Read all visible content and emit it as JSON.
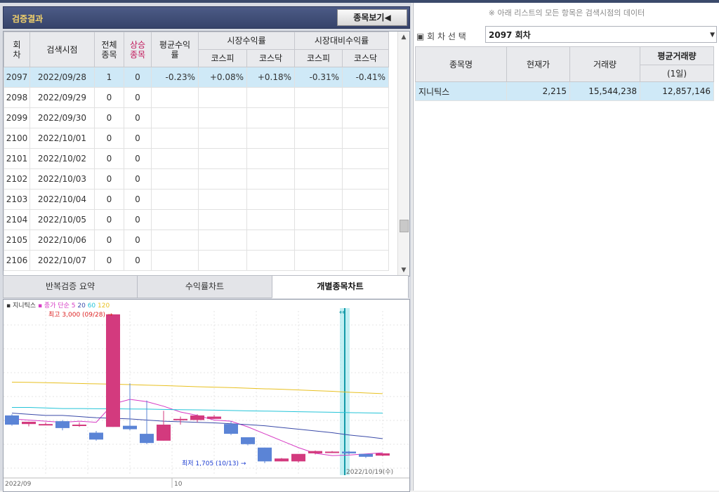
{
  "left": {
    "title": "검증결과",
    "view_button": "종목보기◀",
    "grid": {
      "headers": {
        "round": "회차",
        "date": "검색시점",
        "total": "전체종목",
        "rise": "상승종목",
        "avg": "평균수익률",
        "market": "시장수익률",
        "vs_market": "시장대비수익률",
        "kospi": "코스피",
        "kosdaq": "코스닥",
        "kospi2": "코스피",
        "kosdaq2": "코스닥"
      },
      "rows": [
        {
          "round": "2097",
          "date": "2022/09/28",
          "total": "1",
          "rise": "0",
          "avg": "-0.23%",
          "m_kospi": "+0.08%",
          "m_kosdaq": "+0.18%",
          "v_kospi": "-0.31%",
          "v_kosdaq": "-0.41%"
        },
        {
          "round": "2098",
          "date": "2022/09/29",
          "total": "0",
          "rise": "0",
          "avg": "",
          "m_kospi": "",
          "m_kosdaq": "",
          "v_kospi": "",
          "v_kosdaq": ""
        },
        {
          "round": "2099",
          "date": "2022/09/30",
          "total": "0",
          "rise": "0",
          "avg": "",
          "m_kospi": "",
          "m_kosdaq": "",
          "v_kospi": "",
          "v_kosdaq": ""
        },
        {
          "round": "2100",
          "date": "2022/10/01",
          "total": "0",
          "rise": "0",
          "avg": "",
          "m_kospi": "",
          "m_kosdaq": "",
          "v_kospi": "",
          "v_kosdaq": ""
        },
        {
          "round": "2101",
          "date": "2022/10/02",
          "total": "0",
          "rise": "0",
          "avg": "",
          "m_kospi": "",
          "m_kosdaq": "",
          "v_kospi": "",
          "v_kosdaq": ""
        },
        {
          "round": "2102",
          "date": "2022/10/03",
          "total": "0",
          "rise": "0",
          "avg": "",
          "m_kospi": "",
          "m_kosdaq": "",
          "v_kospi": "",
          "v_kosdaq": ""
        },
        {
          "round": "2103",
          "date": "2022/10/04",
          "total": "0",
          "rise": "0",
          "avg": "",
          "m_kospi": "",
          "m_kosdaq": "",
          "v_kospi": "",
          "v_kosdaq": ""
        },
        {
          "round": "2104",
          "date": "2022/10/05",
          "total": "0",
          "rise": "0",
          "avg": "",
          "m_kospi": "",
          "m_kosdaq": "",
          "v_kospi": "",
          "v_kosdaq": ""
        },
        {
          "round": "2105",
          "date": "2022/10/06",
          "total": "0",
          "rise": "0",
          "avg": "",
          "m_kospi": "",
          "m_kosdaq": "",
          "v_kospi": "",
          "v_kosdaq": ""
        },
        {
          "round": "2106",
          "date": "2022/10/07",
          "total": "0",
          "rise": "0",
          "avg": "",
          "m_kospi": "",
          "m_kosdaq": "",
          "v_kospi": "",
          "v_kosdaq": ""
        }
      ]
    },
    "tabs": [
      "반복검증 요약",
      "수익률차트",
      "개별종목차트"
    ]
  },
  "chart_data": {
    "type": "candlestick",
    "legend": {
      "stock": "지니틱스",
      "ma_label": "종가 단순",
      "periods": [
        "5",
        "20",
        "60",
        "120"
      ],
      "colors": [
        "#d63ac4",
        "#3a4aa8",
        "#24c4d8",
        "#e8c020"
      ]
    },
    "high_label": "최고 3,000 (09/28)",
    "low_label": "최저 1,705 (10/13)",
    "cursor_label": "2022/10/19(수)",
    "x_labels": [
      "2022/09",
      "10"
    ],
    "y_range": [
      1600,
      3030
    ],
    "candles": [
      {
        "o": 2120,
        "h": 2130,
        "l": 2030,
        "c": 2040
      },
      {
        "o": 2045,
        "h": 2065,
        "l": 2025,
        "c": 2065
      },
      {
        "o": 2045,
        "h": 2060,
        "l": 2035,
        "c": 2045
      },
      {
        "o": 2070,
        "h": 2080,
        "l": 1990,
        "c": 2010
      },
      {
        "o": 2040,
        "h": 2060,
        "l": 2020,
        "c": 2040
      },
      {
        "o": 1970,
        "h": 1985,
        "l": 1900,
        "c": 1910
      },
      {
        "o": 2020,
        "h": 3000,
        "l": 2020,
        "c": 3000
      },
      {
        "o": 2030,
        "h": 2400,
        "l": 1990,
        "c": 2000
      },
      {
        "o": 1960,
        "h": 2250,
        "l": 1870,
        "c": 1880
      },
      {
        "o": 1900,
        "h": 2160,
        "l": 1900,
        "c": 2040
      },
      {
        "o": 2090,
        "h": 2110,
        "l": 2040,
        "c": 2090
      },
      {
        "o": 2080,
        "h": 2130,
        "l": 2060,
        "c": 2120
      },
      {
        "o": 2090,
        "h": 2125,
        "l": 2090,
        "c": 2110
      },
      {
        "o": 2045,
        "h": 2070,
        "l": 1950,
        "c": 1960
      },
      {
        "o": 1930,
        "h": 1930,
        "l": 1860,
        "c": 1870
      },
      {
        "o": 1840,
        "h": 1840,
        "l": 1705,
        "c": 1720
      },
      {
        "o": 1720,
        "h": 1750,
        "l": 1720,
        "c": 1745
      },
      {
        "o": 1720,
        "h": 1780,
        "l": 1710,
        "c": 1785
      },
      {
        "o": 1790,
        "h": 1815,
        "l": 1780,
        "c": 1810
      },
      {
        "o": 1805,
        "h": 1810,
        "l": 1800,
        "c": 1805
      },
      {
        "o": 1805,
        "h": 1810,
        "l": 1780,
        "c": 1790
      },
      {
        "o": 1785,
        "h": 1785,
        "l": 1750,
        "c": 1760
      },
      {
        "o": 1770,
        "h": 1790,
        "l": 1765,
        "c": 1790
      }
    ],
    "ma": {
      "5": [
        2090,
        2080,
        2070,
        2060,
        2070,
        2060,
        2220,
        2260,
        2240,
        2200,
        2150,
        2120,
        2080,
        2070,
        2020,
        1960,
        1900,
        1840,
        1790,
        1770,
        1775,
        1785,
        1795
      ],
      "20": [
        2140,
        2130,
        2120,
        2120,
        2110,
        2100,
        2095,
        2090,
        2080,
        2070,
        2065,
        2060,
        2055,
        2048,
        2040,
        2030,
        2015,
        2000,
        1985,
        1970,
        1950,
        1935,
        1918
      ],
      "60": [
        2190,
        2190,
        2185,
        2180,
        2180,
        2178,
        2178,
        2176,
        2175,
        2172,
        2170,
        2168,
        2166,
        2163,
        2160,
        2158,
        2155,
        2152,
        2150,
        2148,
        2145,
        2142,
        2140
      ],
      "120": [
        2410,
        2408,
        2405,
        2402,
        2398,
        2395,
        2392,
        2388,
        2384,
        2380,
        2375,
        2370,
        2366,
        2362,
        2357,
        2352,
        2348,
        2342,
        2336,
        2330,
        2322,
        2316,
        2310
      ]
    }
  },
  "right": {
    "notice": "※ 아래 리스트의 모든 항목은 검색시점의 데이터",
    "select_label": "회 차 선 택",
    "select_value": "2097 회차",
    "table": {
      "headers": {
        "name": "종목명",
        "price": "현재가",
        "volume": "거래량",
        "avg_volume": "평균거래량",
        "avg_sub": "(1일)"
      },
      "rows": [
        {
          "name": "지니틱스",
          "price": "2,215",
          "volume": "15,544,238",
          "avg_volume": "12,857,146"
        }
      ]
    }
  }
}
